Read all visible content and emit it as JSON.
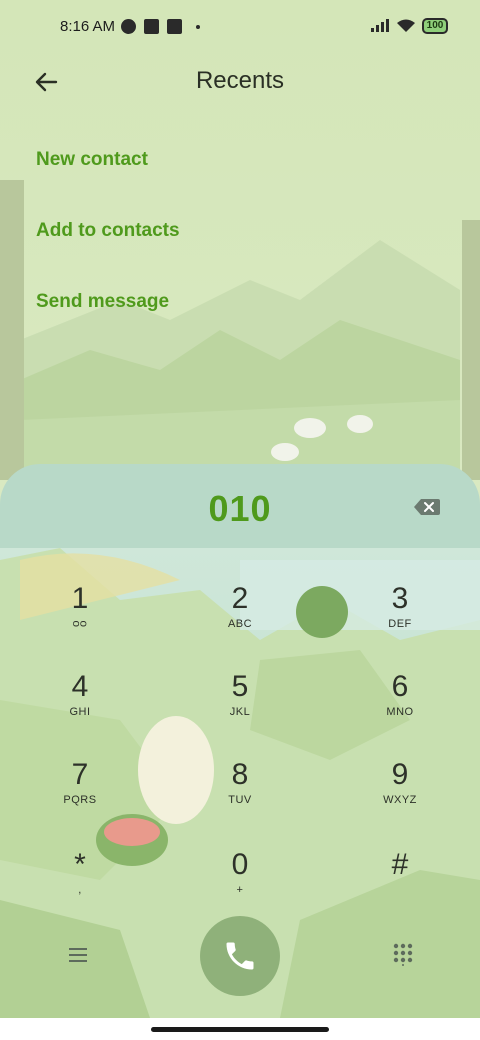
{
  "status_bar": {
    "time": "8:16 AM",
    "battery": "100",
    "icons": [
      "data-saver-icon",
      "stop-icon",
      "upload-icon",
      "dot-icon",
      "signal-icon",
      "wifi-icon",
      "battery-icon"
    ]
  },
  "header": {
    "title": "Recents",
    "back_icon": "back-arrow-icon"
  },
  "menu": {
    "items": [
      {
        "label": "New contact"
      },
      {
        "label": "Add to contacts"
      },
      {
        "label": "Send message"
      }
    ]
  },
  "dialer": {
    "number": "010",
    "backspace_icon": "backspace-icon",
    "keys": [
      {
        "digit": "1",
        "letters": "ᴑᴑ"
      },
      {
        "digit": "2",
        "letters": "ABC"
      },
      {
        "digit": "3",
        "letters": "DEF"
      },
      {
        "digit": "4",
        "letters": "GHI"
      },
      {
        "digit": "5",
        "letters": "JKL"
      },
      {
        "digit": "6",
        "letters": "MNO"
      },
      {
        "digit": "7",
        "letters": "PQRS"
      },
      {
        "digit": "8",
        "letters": "TUV"
      },
      {
        "digit": "9",
        "letters": "WXYZ"
      },
      {
        "digit": "*",
        "letters": ","
      },
      {
        "digit": "0",
        "letters": "+"
      },
      {
        "digit": "#",
        "letters": ""
      }
    ],
    "call_icon": "phone-icon",
    "menu_icon": "menu-icon",
    "dialpad_icon": "dialpad-icon"
  },
  "colors": {
    "accent": "#4f9a1c",
    "panel": "#b8d9c8",
    "call_button": "#8fb17a"
  }
}
